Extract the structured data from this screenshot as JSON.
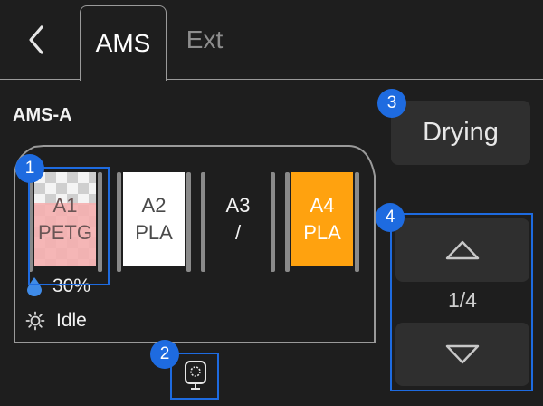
{
  "tabs": {
    "back_icon": "chevron-left-icon",
    "active": "AMS",
    "inactive": "Ext"
  },
  "ams": {
    "title": "AMS-A",
    "slots": [
      {
        "id": "A1",
        "material": "PETG",
        "color": "#f4b0b0",
        "pattern": "checker-transparent"
      },
      {
        "id": "A2",
        "material": "PLA",
        "color": "#ffffff"
      },
      {
        "id": "A3",
        "material": "/",
        "color": "#1e1e1e"
      },
      {
        "id": "A4",
        "material": "PLA",
        "color": "#ffa20f"
      }
    ],
    "humidity": "30%",
    "humidity_icon": "droplet-icon",
    "status": "Idle",
    "status_icon": "sun-icon"
  },
  "drying_button": "Drying",
  "pager": {
    "indicator": "1/4",
    "up_icon": "triangle-up-icon",
    "down_icon": "triangle-down-icon"
  },
  "feeder_icon": "feeder-icon",
  "annotations": [
    "1",
    "2",
    "3",
    "4"
  ],
  "colors": {
    "background": "#1e1e1e",
    "button": "#2f2f2f",
    "annotation": "#1e6be0",
    "accent_orange": "#ffa20f"
  }
}
